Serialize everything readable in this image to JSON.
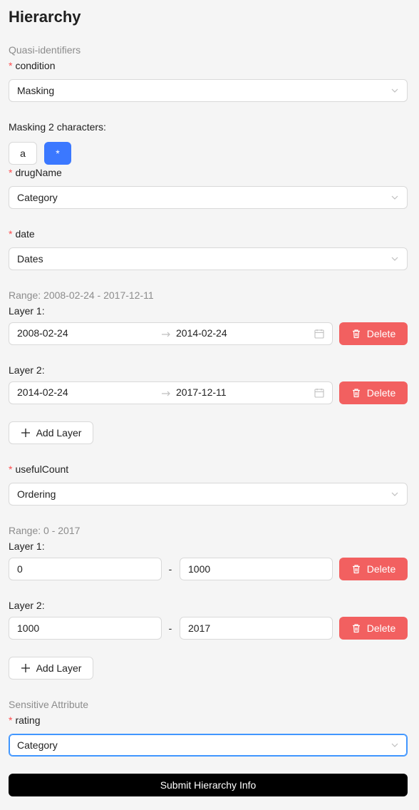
{
  "page": {
    "title": "Hierarchy"
  },
  "quasi_identifiers": {
    "section_label": "Quasi-identifiers",
    "condition": {
      "label": "condition",
      "selected": "Masking",
      "masking_text": "Masking 2 characters:",
      "mask_buttons": [
        "a",
        "*"
      ],
      "active_mask": "*"
    },
    "drugName": {
      "label": "drugName",
      "selected": "Category"
    },
    "date": {
      "label": "date",
      "selected": "Dates",
      "range_text": "Range: 2008-02-24 - 2017-12-11",
      "layers": [
        {
          "label": "Layer 1:",
          "start": "2008-02-24",
          "end": "2014-02-24",
          "delete_label": "Delete"
        },
        {
          "label": "Layer 2:",
          "start": "2014-02-24",
          "end": "2017-12-11",
          "delete_label": "Delete"
        }
      ],
      "add_layer_label": "Add Layer"
    },
    "usefulCount": {
      "label": "usefulCount",
      "selected": "Ordering",
      "range_text": "Range: 0 - 2017",
      "layers": [
        {
          "label": "Layer 1:",
          "from": "0",
          "to": "1000",
          "separator": "-",
          "delete_label": "Delete"
        },
        {
          "label": "Layer 2:",
          "from": "1000",
          "to": "2017",
          "separator": "-",
          "delete_label": "Delete"
        }
      ],
      "add_layer_label": "Add Layer"
    }
  },
  "sensitive": {
    "section_label": "Sensitive Attribute",
    "rating": {
      "label": "rating",
      "selected": "Category"
    }
  },
  "submit_label": "Submit Hierarchy Info",
  "required_marker": "*",
  "colors": {
    "accent": "#3b78ff",
    "danger": "#f26060",
    "required": "#ff4d4f"
  },
  "icons": [
    "chevron-down-icon",
    "arrow-right-icon",
    "calendar-icon",
    "delete-icon",
    "plus-icon"
  ]
}
